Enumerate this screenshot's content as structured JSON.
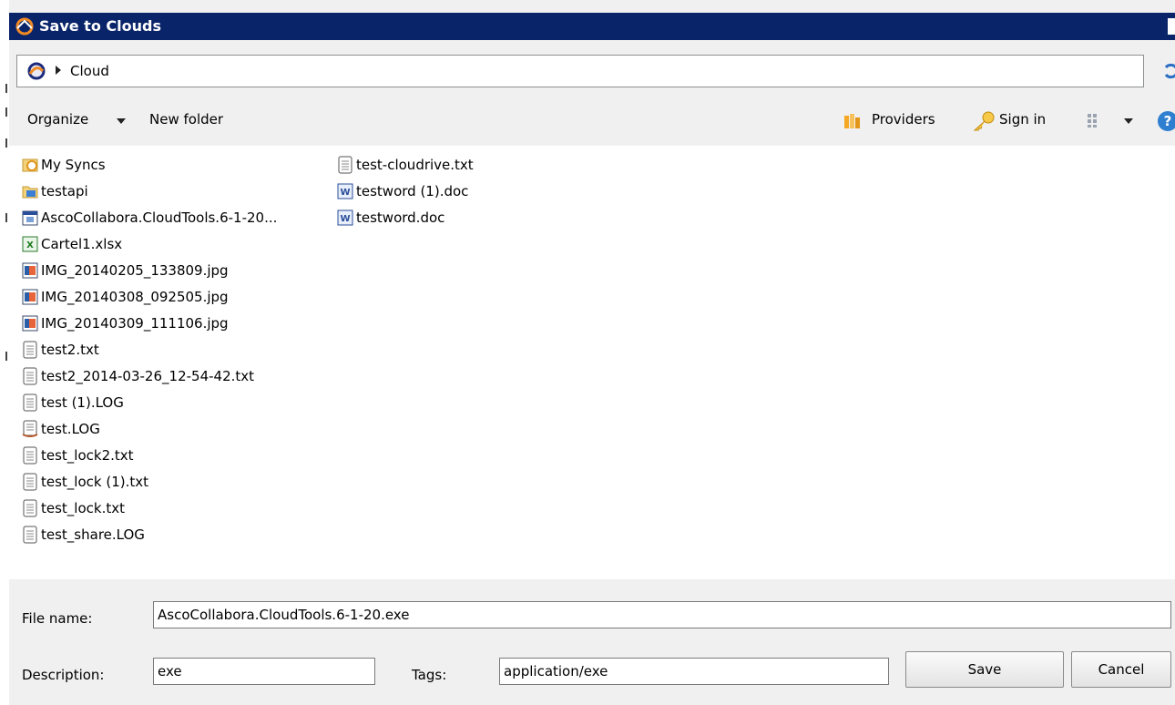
{
  "window": {
    "title": "Save to Clouds"
  },
  "address": {
    "path": "Cloud"
  },
  "toolbar": {
    "organize_label": "Organize",
    "new_folder_label": "New folder",
    "providers_label": "Providers",
    "sign_in_label": "Sign in"
  },
  "files": {
    "col1": [
      {
        "name": "My Syncs",
        "icon": "syncs-folder-icon"
      },
      {
        "name": "testapi",
        "icon": "folder-icon"
      },
      {
        "name": "AscoCollabora.CloudTools.6-1-20...",
        "icon": "exe-file-icon"
      },
      {
        "name": "Cartel1.xlsx",
        "icon": "excel-file-icon"
      },
      {
        "name": "IMG_20140205_133809.jpg",
        "icon": "image-file-icon"
      },
      {
        "name": "IMG_20140308_092505.jpg",
        "icon": "image-file-icon"
      },
      {
        "name": "IMG_20140309_111106.jpg",
        "icon": "image-file-icon"
      },
      {
        "name": "test2.txt",
        "icon": "text-file-icon"
      },
      {
        "name": "test2_2014-03-26_12-54-42.txt",
        "icon": "text-file-icon"
      },
      {
        "name": "test (1).LOG",
        "icon": "text-file-icon"
      },
      {
        "name": "test.LOG",
        "icon": "log-file-icon"
      },
      {
        "name": "test_lock2.txt",
        "icon": "text-file-icon"
      },
      {
        "name": "test_lock (1).txt",
        "icon": "text-file-icon"
      },
      {
        "name": "test_lock.txt",
        "icon": "text-file-icon"
      },
      {
        "name": "test_share.LOG",
        "icon": "text-file-icon"
      }
    ],
    "col2": [
      {
        "name": "test-cloudrive.txt",
        "icon": "text-file-icon"
      },
      {
        "name": "testword (1).doc",
        "icon": "word-file-icon"
      },
      {
        "name": "testword.doc",
        "icon": "word-file-icon"
      }
    ]
  },
  "form": {
    "file_name_label": "File name:",
    "file_name_value": "AscoCollabora.CloudTools.6-1-20.exe",
    "description_label": "Description:",
    "description_value": "exe",
    "tags_label": "Tags:",
    "tags_value": "application/exe",
    "save_label": "Save",
    "cancel_label": "Cancel"
  },
  "colors": {
    "titlebar": "#0a246a",
    "pane": "#ffffff",
    "chrome": "#f0f0f0"
  }
}
